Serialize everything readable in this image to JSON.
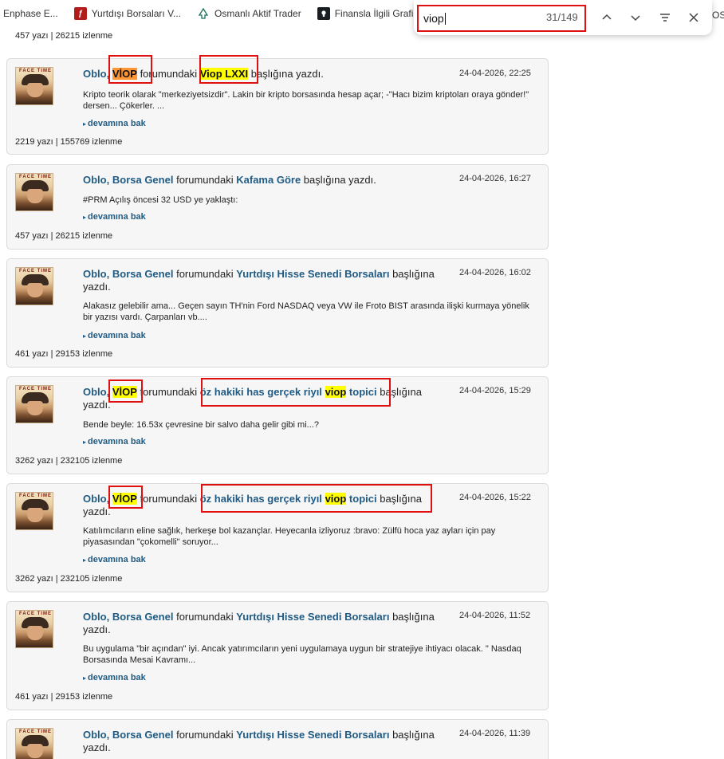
{
  "bookmarks": [
    {
      "label": "Enphase E...",
      "icon": "none"
    },
    {
      "label": "Yurtdışı Borsaları V...",
      "icon": "red-feather-icon"
    },
    {
      "label": "Osmanlı Aktif Trader",
      "icon": "tree-icon"
    },
    {
      "label": "Finansla İlgili Grafi...",
      "icon": "github-icon"
    }
  ],
  "find": {
    "query": "viop",
    "count": "31/149"
  },
  "os_fragment": "OS",
  "top_stats": "457 yazı | 26215 izlenme",
  "colors": {
    "link": "#1f5b84",
    "match_highlight": "#ffff00",
    "active_match": "#ff9632",
    "annotation": "#e01010",
    "card_bg": "#f6f6f6"
  },
  "posts": [
    {
      "author": "Oblo",
      "forum": "VİOP",
      "forum_mid": "forumundaki",
      "topic": "Viop LXXI",
      "suffix": "başlığına yazdı.",
      "date": "24-04-2026, 22:25",
      "excerpt": "Kripto teorik olarak \"merkeziyetsizdir\". Lakin bir kripto borsasında hesap açar; -\"Hacı bizim kriptoları oraya gönder!\" dersen... Çökerler. ...",
      "more": "devamına bak",
      "stats": "2219 yazı | 155769 izlenme"
    },
    {
      "author": "Oblo",
      "forum": "Borsa Genel",
      "forum_mid": "forumundaki",
      "topic": "Kafama Göre",
      "suffix": "başlığına yazdı.",
      "date": "24-04-2026, 16:27",
      "excerpt": "#PRM Açılış öncesi 32 USD ye yaklaştı:",
      "more": "devamına bak",
      "stats": "457 yazı | 26215 izlenme"
    },
    {
      "author": "Oblo",
      "forum": "Borsa Genel",
      "forum_mid": "forumundaki",
      "topic": "Yurtdışı Hisse Senedi Borsaları",
      "suffix": "başlığına yazdı.",
      "date": "24-04-2026, 16:02",
      "excerpt": "Alakasız gelebilir ama... Geçen sayın TH'nin Ford NASDAQ veya VW ile Froto BIST arasında ilişki kurmaya yönelik bir yazısı vardı. Çarpanları vb....",
      "more": "devamına bak",
      "stats": "461 yazı | 29153 izlenme"
    },
    {
      "author": "Oblo",
      "forum": "VİOP",
      "forum_mid": "forumundaki",
      "topic_a": "öz hakiki has gerçek riyıl",
      "topic_hl": "viop",
      "topic_b": "topici",
      "suffix": "başlığına yazdı.",
      "date": "24-04-2026, 15:29",
      "excerpt": "Bende beyle: 16.53x çevresine bir salvo daha gelir gibi mi...?",
      "more": "devamına bak",
      "stats": "3262 yazı | 232105 izlenme"
    },
    {
      "author": "Oblo",
      "forum": "VİOP",
      "forum_mid": "forumundaki",
      "topic_a": "öz hakiki has gerçek riyıl",
      "topic_hl": "viop",
      "topic_b": "topici",
      "suffix": "başlığına yazdı.",
      "date": "24-04-2026, 15:22",
      "excerpt": "Katılımcıların eline sağlık, herkeşe bol kazançlar. Heyecanla izliyoruz :bravo: Zülfü hoca yaz ayları için pay piyasasından \"çokomelli\" soruyor...",
      "more": "devamına bak",
      "stats": "3262 yazı | 232105 izlenme"
    },
    {
      "author": "Oblo",
      "forum": "Borsa Genel",
      "forum_mid": "forumundaki",
      "topic": "Yurtdışı Hisse Senedi Borsaları",
      "suffix": "başlığına yazdı.",
      "date": "24-04-2026, 11:52",
      "excerpt": "Bu uygulama \"bir açından\" iyi. Ancak yatırımcıların yeni uygulamaya uygun bir stratejiye ihtiyacı olacak. \" Nasdaq Borsasında Mesai Kavramı...",
      "more": "devamına bak",
      "stats": "461 yazı | 29153 izlenme"
    },
    {
      "author": "Oblo",
      "forum": "Borsa Genel",
      "forum_mid": "forumundaki",
      "topic": "Yurtdışı Hisse Senedi Borsaları",
      "suffix": "başlığına yazdı.",
      "date": "24-04-2026, 11:39"
    }
  ]
}
